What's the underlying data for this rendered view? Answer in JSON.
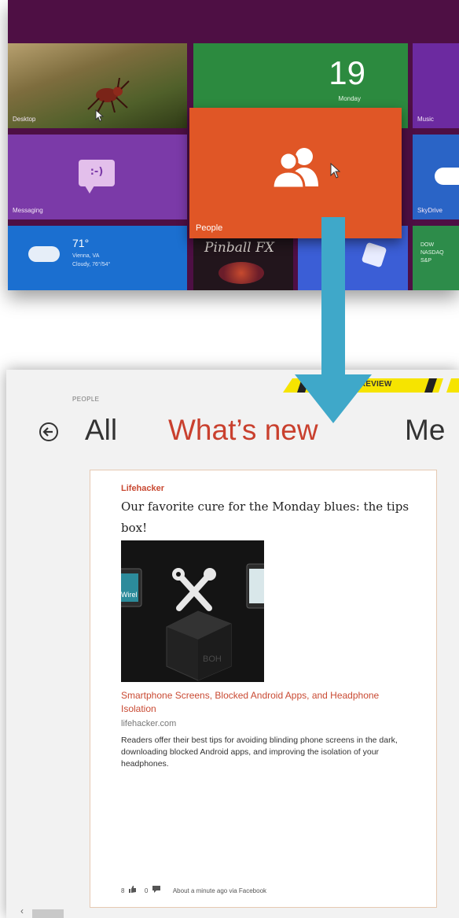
{
  "start_screen": {
    "tiles": {
      "desktop": "Desktop",
      "calendar_date": "19",
      "calendar_day": "Monday",
      "music": "Music",
      "messaging": "Messaging",
      "messaging_glyph": ":-)",
      "skydrive": "SkyDrive",
      "weather_temp": "71°",
      "weather_location": "Vienna, VA",
      "weather_condition": "Cloudy, 76°/54°",
      "pinball": "Pinball FX",
      "people": "People",
      "finance_lines": [
        "DOW",
        "NASDAQ",
        "S&P"
      ]
    }
  },
  "app": {
    "banner": "APP PREVIEW",
    "section": "PEOPLE",
    "pivots": [
      "All",
      "What’s new",
      "Me"
    ],
    "selected_pivot": "What’s new",
    "feed_item": {
      "source": "Lifehacker",
      "headline": "Our favorite cure for the Monday blues: the tips box!",
      "link_title": "Smartphone Screens, Blocked Android Apps, and Headphone Isolation",
      "domain": "lifehacker.com",
      "description": "Readers offer their best tips for avoiding blinding phone screens in the dark, downloading blocked Android apps, and improving the isolation of your headphones.",
      "likes": "8",
      "comments": "0",
      "timestamp": "About a minute ago via Facebook",
      "thumbnail_text": [
        "BOH",
        "Wirel"
      ]
    }
  },
  "colors": {
    "start_background": "#4e0f44",
    "people_tile": "#e05626",
    "accent": "#c9402e",
    "arrow": "#3fa8c9"
  },
  "icons": {
    "back": "back-arrow-icon",
    "people": "people-icon",
    "like": "thumbs-up-icon",
    "comment": "comment-icon",
    "cursor": "mouse-pointer-icon",
    "transition": "down-arrow-icon"
  }
}
